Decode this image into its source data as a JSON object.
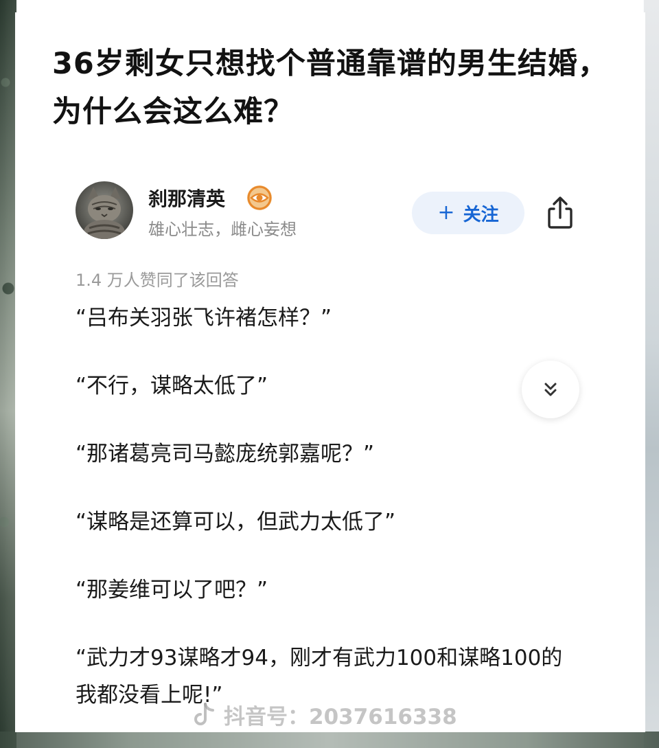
{
  "question": {
    "title": "36岁剩女只想找个普通靠谱的男生结婚，为什么会这么难？"
  },
  "author": {
    "name": "刹那清英",
    "bio": "雄心壮志，雌心妄想",
    "badge_icon": "eye-badge-icon",
    "avatar_icon": "cat-avatar"
  },
  "actions": {
    "follow_plus": "+",
    "follow_label": "关注",
    "share_icon": "share-icon",
    "expand_icon": "double-chevron-down-icon"
  },
  "answer": {
    "votes": "1.4 万人赞同了该回答",
    "lines": [
      "“吕布关羽张飞许褚怎样？”",
      "“不行，谋略太低了”",
      "“那诸葛亮司马懿庞统郭嘉呢？”",
      "“谋略是还算可以，但武力太低了”",
      "“那姜维可以了吧？”",
      "“武力才93谋略才94，刚才有武力100和谋略100的我都没看上呢!”"
    ]
  },
  "watermark": {
    "text": "抖音号：2037616338",
    "icon": "douyin-logo-icon"
  },
  "colors": {
    "accent": "#1766d4",
    "follow_bg": "#ecf2fb",
    "badge": "#e8892c",
    "muted": "#8a8a8a"
  }
}
